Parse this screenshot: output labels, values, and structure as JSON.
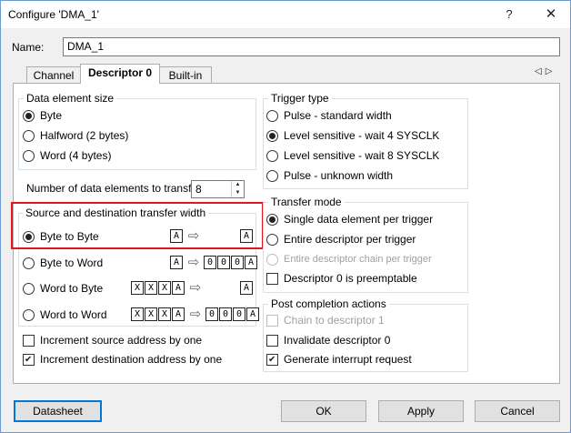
{
  "window": {
    "title": "Configure 'DMA_1'",
    "help_glyph": "?",
    "close_glyph": "✕"
  },
  "name": {
    "label": "Name:",
    "value": "DMA_1"
  },
  "tabs": [
    {
      "label": "Channel",
      "active": false
    },
    {
      "label": "Descriptor 0",
      "active": true
    },
    {
      "label": "Built-in",
      "active": false
    }
  ],
  "tab_scroll": {
    "left": "◁",
    "right": "▷"
  },
  "data_element_size": {
    "label": "Data element size",
    "options": [
      {
        "label": "Byte",
        "checked": true
      },
      {
        "label": "Halfword (2 bytes)",
        "checked": false
      },
      {
        "label": "Word (4 bytes)",
        "checked": false
      }
    ]
  },
  "num_elements": {
    "label": "Number of data elements to transfer:",
    "value": "8"
  },
  "transfer_width": {
    "label": "Source and destination transfer width",
    "options": [
      {
        "label": "Byte to Byte",
        "checked": true,
        "src": [
          "A"
        ],
        "dst": [
          "A"
        ]
      },
      {
        "label": "Byte to Word",
        "checked": false,
        "src": [
          "A"
        ],
        "dst": [
          "0",
          "0",
          "0",
          "A"
        ]
      },
      {
        "label": "Word to Byte",
        "checked": false,
        "src": [
          "X",
          "X",
          "X",
          "A"
        ],
        "dst": [
          "A"
        ]
      },
      {
        "label": "Word to Word",
        "checked": false,
        "src": [
          "X",
          "X",
          "X",
          "A"
        ],
        "dst": [
          "0",
          "0",
          "0",
          "A"
        ]
      }
    ],
    "arrow": "⇨"
  },
  "increment": {
    "source": {
      "label": "Increment source address by one",
      "checked": false
    },
    "destination": {
      "label": "Increment destination address by one",
      "checked": true
    }
  },
  "trigger_type": {
    "label": "Trigger type",
    "options": [
      {
        "label": "Pulse - standard width",
        "checked": false
      },
      {
        "label": "Level sensitive - wait 4 SYSCLK",
        "checked": true
      },
      {
        "label": "Level sensitive - wait 8 SYSCLK",
        "checked": false
      },
      {
        "label": "Pulse - unknown width",
        "checked": false
      }
    ]
  },
  "transfer_mode": {
    "label": "Transfer mode",
    "options": [
      {
        "label": "Single data element per trigger",
        "checked": true,
        "disabled": false
      },
      {
        "label": "Entire descriptor per trigger",
        "checked": false,
        "disabled": false
      },
      {
        "label": "Entire descriptor chain per trigger",
        "checked": false,
        "disabled": true
      }
    ],
    "preemptable": {
      "label": "Descriptor 0 is preemptable",
      "checked": false
    }
  },
  "post_completion": {
    "label": "Post completion actions",
    "chain": {
      "label": "Chain to descriptor 1",
      "checked": false,
      "disabled": true
    },
    "invalidate": {
      "label": "Invalidate descriptor 0",
      "checked": false
    },
    "interrupt": {
      "label": "Generate interrupt request",
      "checked": true
    }
  },
  "buttons": {
    "datasheet": "Datasheet",
    "ok": "OK",
    "apply": "Apply",
    "cancel": "Cancel"
  }
}
